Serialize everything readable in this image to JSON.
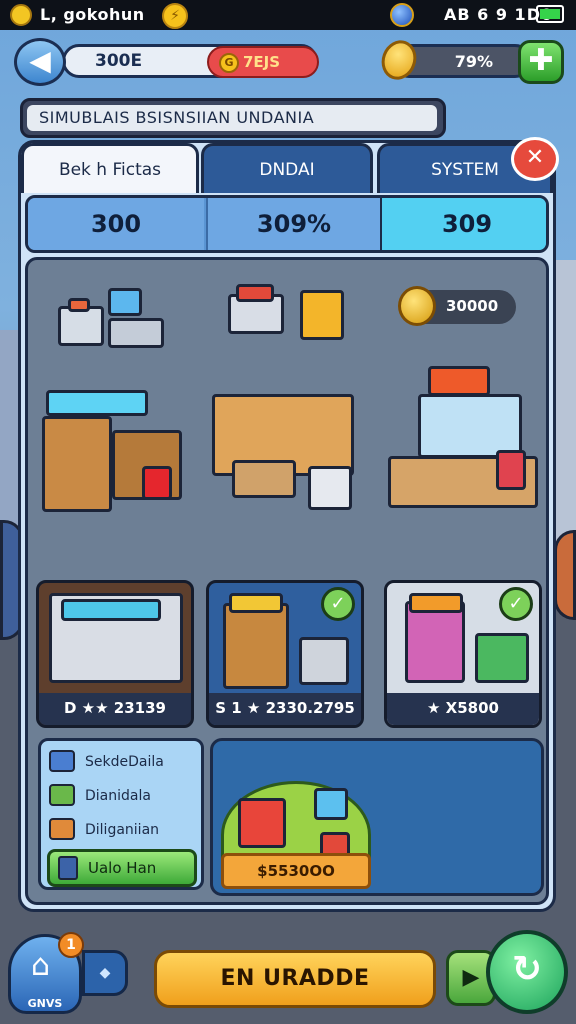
{
  "status_bar": {
    "carrier": "L, gokohun",
    "time": "AB 6 9 1D0",
    "icons": [
      "coin-icon",
      "bolt-coin-icon",
      "globe-icon",
      "battery-icon"
    ]
  },
  "top_bar": {
    "cash": "300E",
    "gems": "7EJS",
    "percent": "79%",
    "icons": [
      "back-arrow-icon",
      "gem-coin-icon",
      "gold-coin-icon",
      "plus-icon"
    ]
  },
  "title": "SIMUBLAIS BSISNSIIAN UNDANIA",
  "tabs": [
    {
      "label": "Bek h Fictas",
      "active": true
    },
    {
      "label": "DNDAI",
      "active": false
    },
    {
      "label": "SYSTEM",
      "active": false
    }
  ],
  "stats": [
    {
      "value": "300"
    },
    {
      "value": "309%"
    },
    {
      "value": "309",
      "highlight": true
    }
  ],
  "shop": {
    "coin_balance": "30000",
    "cards": [
      {
        "price": "D ★★ 23139",
        "checked": false
      },
      {
        "price": "S 1 ★ 2330.2795",
        "checked": true
      },
      {
        "price": "★ X5800",
        "checked": true
      }
    ],
    "side_list": [
      {
        "label": "SekdeDaila",
        "icon": "crate-icon",
        "color": "#4a7ed1"
      },
      {
        "label": "Dianidala",
        "icon": "fridge-icon",
        "color": "#6ab84a"
      },
      {
        "label": "Diliganiian",
        "icon": "box-icon",
        "color": "#e08a3a"
      }
    ],
    "side_button": {
      "label": "Ualo Han",
      "icon": "phone-icon"
    },
    "featured_price": "$5530OO"
  },
  "bottom_nav": {
    "home_label": "GNVS",
    "home_badge": "1",
    "upgrade_label": "EN URADDE",
    "icons": [
      "home-icon",
      "menu-icon",
      "arrow-icon",
      "cycle-icon"
    ]
  },
  "colors": {
    "accent": "#2d5a98",
    "upgrade": "#f0a01c",
    "confirm": "#3eaa38",
    "alert": "#e64a3c"
  }
}
